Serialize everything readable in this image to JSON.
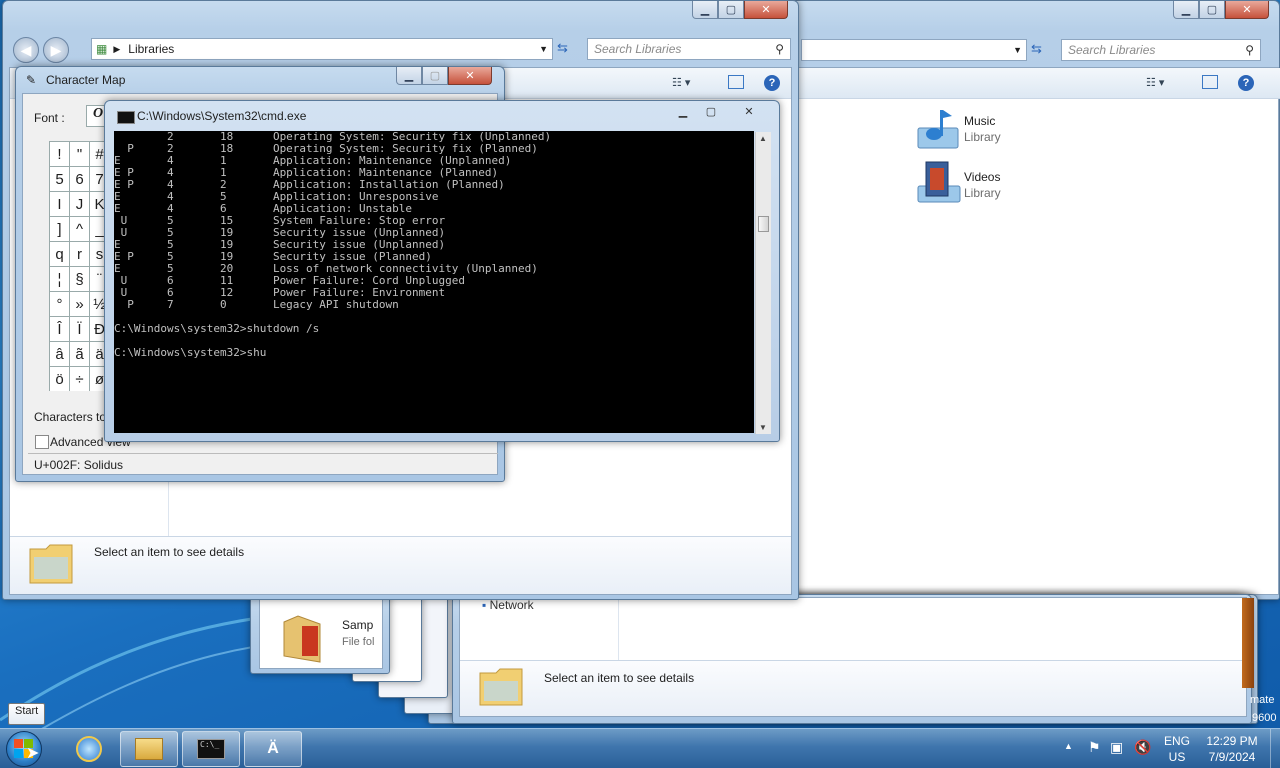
{
  "explorer_back": {
    "search_placeholder": "Search Libraries",
    "items": [
      {
        "name": "Music",
        "sub": "Library",
        "icon": "music-library-icon"
      },
      {
        "name": "Videos",
        "sub": "Library",
        "icon": "videos-library-icon"
      }
    ]
  },
  "explorer_front": {
    "breadcrumb": "Libraries",
    "search_placeholder": "Search Libraries",
    "details_text": "Select an item to see details"
  },
  "explorer_bottom": {
    "nav_item": "Network",
    "item_name": "Samp",
    "item_sub": "File fol",
    "details_text": "Select an item to see details"
  },
  "desktop": {
    "watermark_1": "mate",
    "watermark_2": "9600"
  },
  "charmap": {
    "title": "Character Map",
    "font_label": "Font :",
    "font_value": "O",
    "grid": [
      "!",
      "\"",
      "#",
      "5",
      "6",
      "7",
      "I",
      "J",
      "K",
      "]",
      "^",
      "_",
      "q",
      "r",
      "s",
      "¦",
      "§",
      "¨",
      "°",
      "»",
      "½",
      "Î",
      "Ï",
      "Ð",
      "â",
      "ã",
      "ä",
      "ö",
      "÷",
      "ø"
    ],
    "copy_label": "Characters to c",
    "advanced_label": "Advanced view",
    "status": "U+002F: Solidus"
  },
  "cmd": {
    "title": "C:\\Windows\\System32\\cmd.exe",
    "lines": [
      "        2       18      Operating System: Security fix (Unplanned)",
      "  P     2       18      Operating System: Security fix (Planned)",
      "E       4       1       Application: Maintenance (Unplanned)",
      "E P     4       1       Application: Maintenance (Planned)",
      "E P     4       2       Application: Installation (Planned)",
      "E       4       5       Application: Unresponsive",
      "E       4       6       Application: Unstable",
      " U      5       15      System Failure: Stop error",
      " U      5       19      Security issue (Unplanned)",
      "E       5       19      Security issue (Unplanned)",
      "E P     5       19      Security issue (Planned)",
      "E       5       20      Loss of network connectivity (Unplanned)",
      " U      6       11      Power Failure: Cord Unplugged",
      " U      6       12      Power Failure: Environment",
      "  P     7       0       Legacy API shutdown",
      "",
      "C:\\Windows\\system32>shutdown /s",
      "",
      "C:\\Windows\\system32>shu"
    ]
  },
  "taskbar": {
    "tooltip": "Start",
    "lang_1": "ENG",
    "lang_2": "US",
    "time": "12:29 PM",
    "date": "7/9/2024"
  }
}
